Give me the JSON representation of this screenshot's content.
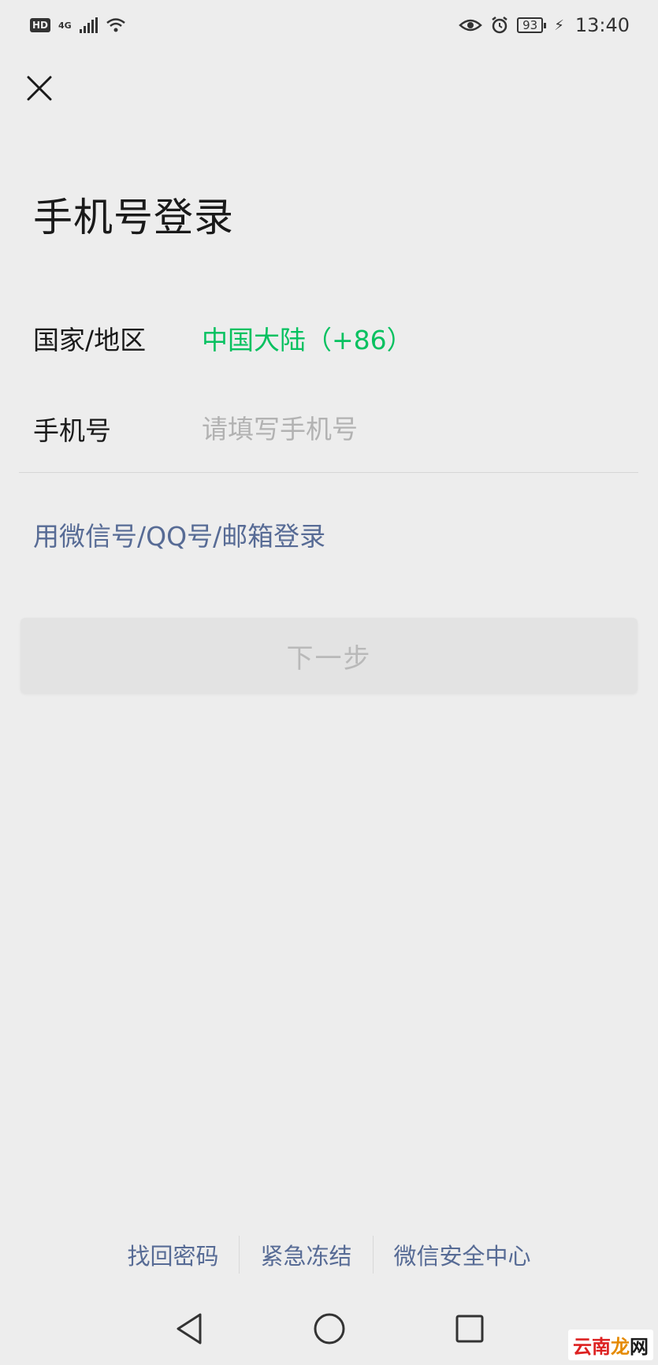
{
  "status_bar": {
    "hd": "HD",
    "network": "4G",
    "battery": "93",
    "time": "13:40"
  },
  "header": {
    "title": "手机号登录"
  },
  "form": {
    "region_label": "国家/地区",
    "region_value": "中国大陆（+86）",
    "phone_label": "手机号",
    "phone_placeholder": "请填写手机号",
    "phone_value": ""
  },
  "alt_login": "用微信号/QQ号/邮箱登录",
  "next_button": {
    "label": "下一步",
    "enabled": false
  },
  "footer": {
    "links": [
      "找回密码",
      "紧急冻结",
      "微信安全中心"
    ]
  },
  "watermark": {
    "part1": "云",
    "part2": "南",
    "part3": "龙",
    "part4": "网"
  },
  "colors": {
    "background": "#ededed",
    "accent_green": "#07c160",
    "link_blue": "#576b95",
    "disabled_button_bg": "#e3e3e3",
    "disabled_button_text": "#b9b9b9"
  }
}
